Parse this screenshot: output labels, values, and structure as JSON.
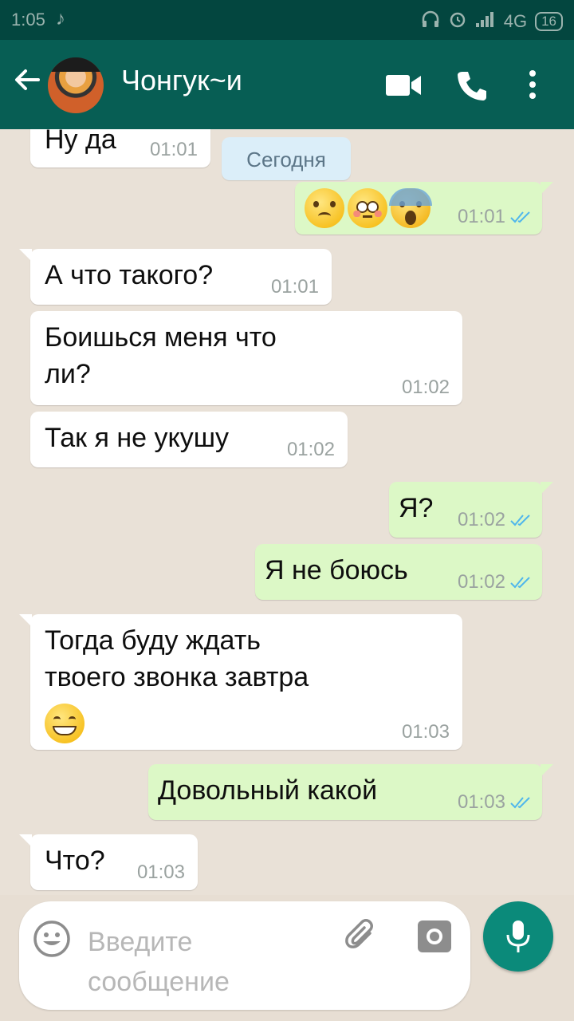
{
  "status_bar": {
    "time": "1:05",
    "network": "4G",
    "battery": "16"
  },
  "header": {
    "contact_name": "Чонгук~и"
  },
  "chat": {
    "date_chip": "Сегодня",
    "messages": [
      {
        "direction": "in",
        "text": "Ну да",
        "time": "01:01"
      },
      {
        "direction": "out",
        "emoji": [
          "worried-face-emoji",
          "flushed-face-emoji",
          "screaming-face-emoji"
        ],
        "time": "01:01",
        "status": "read"
      },
      {
        "direction": "in",
        "text": "А что такого?",
        "time": "01:01"
      },
      {
        "direction": "in",
        "text": "Боишься меня что\nли?",
        "time": "01:02"
      },
      {
        "direction": "in",
        "text": "Так я не укушу",
        "time": "01:02"
      },
      {
        "direction": "out",
        "text": "Я?",
        "time": "01:02",
        "status": "read"
      },
      {
        "direction": "out",
        "text": "Я не боюсь",
        "time": "01:02",
        "status": "read"
      },
      {
        "direction": "in",
        "text": "Тогда буду ждать\nтвоего звонка завтра",
        "emoji": [
          "grinning-face-emoji"
        ],
        "time": "01:03"
      },
      {
        "direction": "out",
        "text": "Довольный какой",
        "time": "01:03",
        "status": "read"
      },
      {
        "direction": "in",
        "text": "Что?",
        "time": "01:03"
      }
    ]
  },
  "input": {
    "placeholder": "Введите\nсообщение"
  },
  "colors": {
    "header": "#075e54",
    "status_bar": "#03463f",
    "outgoing_bubble": "#dcf8c6",
    "incoming_bubble": "#ffffff",
    "read_ticks": "#4fb6ec",
    "mic_button": "#0b8a7a"
  }
}
